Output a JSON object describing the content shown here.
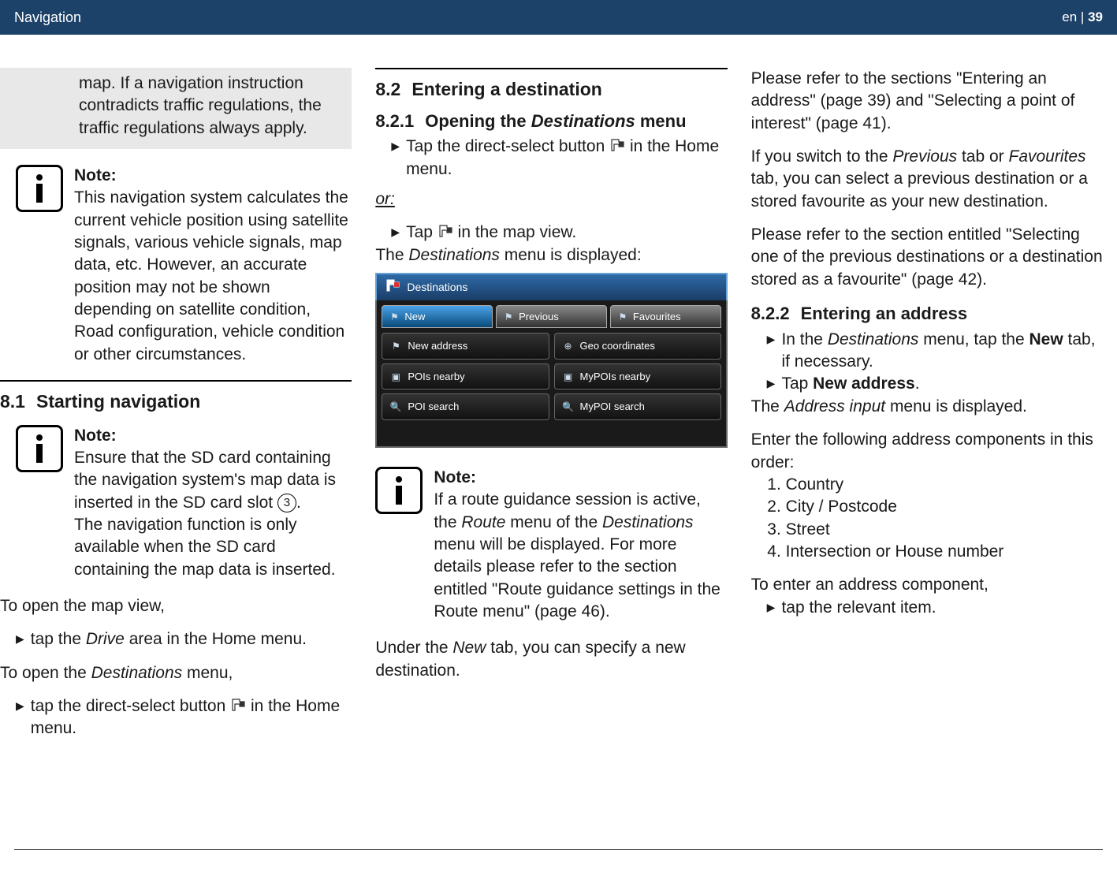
{
  "header": {
    "left": "Navigation",
    "lang": "en",
    "sep": " | ",
    "page": "39"
  },
  "col1": {
    "gray_text": "map. If a navigation instruction contradicts traffic regulations, the traffic regulations always apply.",
    "note1": {
      "label": "Note:",
      "text": "This navigation system calculates the current vehicle position using satellite signals, various vehicle signals, map data, etc. However, an accurate position may not be shown depending on satellite condition, Road configuration, vehicle condition or other circumstances."
    },
    "h81_num": "8.1",
    "h81_title": "Starting navigation",
    "note2": {
      "label": "Note:",
      "line1a": "Ensure that the SD card containing the navigation system's map data is inserted in the SD card slot ",
      "circled": "3",
      "line1b": ".",
      "line2": "The navigation function is only available when the SD card containing the map data is inserted."
    },
    "open_map": "To open the map view,",
    "open_map_step_a": "tap the ",
    "open_map_step_i": "Drive",
    "open_map_step_b": " area in the Home menu.",
    "open_dest_a": "To open the ",
    "open_dest_i": "Destinations",
    "open_dest_b": " menu,",
    "open_dest_step_a": "tap the direct-select button ",
    "open_dest_step_b": " in the Home menu."
  },
  "col2": {
    "h82_num": "8.2",
    "h82_title": "Entering a destination",
    "h821_num": "8.2.1",
    "h821_a": "Opening the ",
    "h821_i": "Destinations",
    "h821_b": " menu",
    "step1_a": "Tap the direct-select button ",
    "step1_b": " in the Home menu.",
    "or": "or:",
    "step2_a": "Tap ",
    "step2_b": " in the map view.",
    "displayed_a": "The ",
    "displayed_i": "Destinations",
    "displayed_b": " menu is displayed:",
    "shot": {
      "title": "Destinations",
      "tabs": [
        "New",
        "Previous",
        "Favourites"
      ],
      "buttons": [
        "New address",
        "Geo coordinates",
        "POIs nearby",
        "MyPOIs nearby",
        "POI search",
        "MyPOI search"
      ]
    },
    "note": {
      "label": "Note:",
      "a": "If a route guidance session is active, the ",
      "i1": "Route",
      "b": " menu of the ",
      "i2": "Destinations",
      "c": " menu will be displayed. For more details please refer to the section entitled \"Route guidance settings in the Route menu\" (page 46)."
    },
    "under_a": "Under the ",
    "under_i": "New",
    "under_b": " tab, you can specify a new destination."
  },
  "col3": {
    "p1": "Please refer to the sections \"Entering an address\" (page 39) and \"Selecting a point of interest\" (page 41).",
    "p2_a": "If you switch to the ",
    "p2_i1": "Previous",
    "p2_b": " tab or ",
    "p2_i2": "Favourites",
    "p2_c": " tab, you can select a previous destination or a stored favourite as your new destination.",
    "p3": "Please refer to the section entitled \"Selecting one of the previous destinations or a destination stored as a favourite\" (page 42).",
    "h822_num": "8.2.2",
    "h822_title": "Entering an address",
    "s1_a": "In the ",
    "s1_i": "Destinations",
    "s1_b": " menu, tap the ",
    "s1_bold": "New",
    "s1_c": " tab, if necessary.",
    "s2_a": "Tap ",
    "s2_bold": "New address",
    "s2_b": ".",
    "disp_a": "The ",
    "disp_i": "Address input",
    "disp_b": " menu is displayed.",
    "enter": "Enter the following address components in this order:",
    "list": [
      "Country",
      "City / Postcode",
      "Street",
      "Intersection or House number"
    ],
    "to_enter": "To enter an address component,",
    "to_enter_step": "tap the relevant item."
  }
}
